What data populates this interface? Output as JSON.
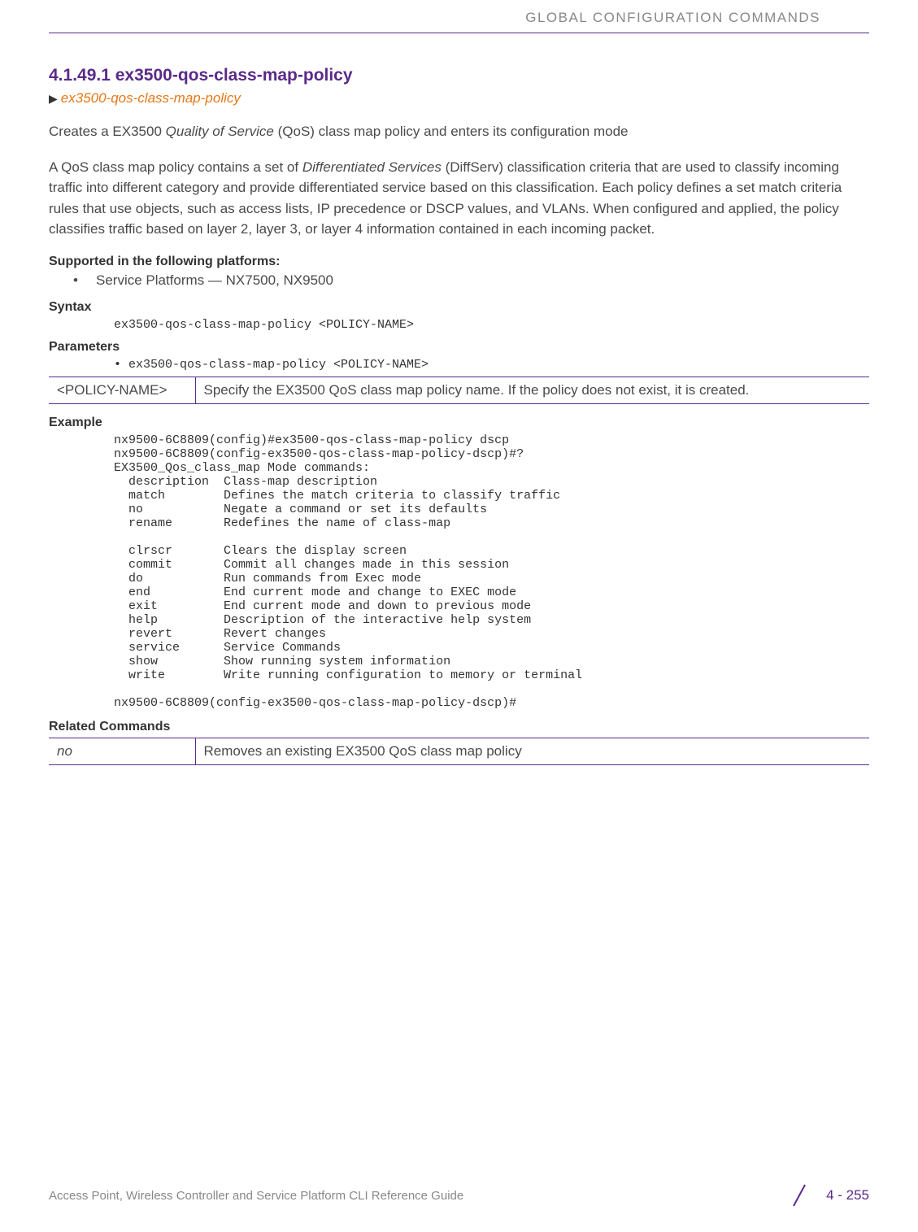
{
  "header": {
    "title": "GLOBAL CONFIGURATION COMMANDS"
  },
  "section": {
    "number": "4.1.49.1",
    "title": "ex3500-qos-class-map-policy",
    "breadcrumb": "ex3500-qos-class-map-policy"
  },
  "intro_pre": "Creates a EX3500 ",
  "intro_italic": "Quality of Service",
  "intro_post": " (QoS) class map policy and enters its configuration mode",
  "desc_pre": "A QoS class map policy contains a set of ",
  "desc_italic": "Differentiated Services",
  "desc_post": " (DiffServ) classification criteria that are used to classify incoming traffic into different category and provide differentiated service based on this classification. Each policy defines a set match criteria rules that use objects, such as access lists, IP precedence or DSCP values, and VLANs. When configured and applied, the policy classifies traffic based on layer 2, layer 3, or layer 4 information contained in each incoming packet.",
  "platforms": {
    "heading": "Supported in the following platforms:",
    "item": "Service Platforms — NX7500, NX9500"
  },
  "syntax": {
    "heading": "Syntax",
    "line": "ex3500-qos-class-map-policy <POLICY-NAME>"
  },
  "parameters": {
    "heading": "Parameters",
    "bullet": "• ex3500-qos-class-map-policy <POLICY-NAME>",
    "name": "<POLICY-NAME>",
    "desc": "Specify the EX3500 QoS class map policy name. If the policy does not exist, it is created."
  },
  "example": {
    "heading": "Example",
    "text": "nx9500-6C8809(config)#ex3500-qos-class-map-policy dscp\nnx9500-6C8809(config-ex3500-qos-class-map-policy-dscp)#?\nEX3500_Qos_class_map Mode commands:\n  description  Class-map description\n  match        Defines the match criteria to classify traffic\n  no           Negate a command or set its defaults\n  rename       Redefines the name of class-map\n\n  clrscr       Clears the display screen\n  commit       Commit all changes made in this session\n  do           Run commands from Exec mode\n  end          End current mode and change to EXEC mode\n  exit         End current mode and down to previous mode\n  help         Description of the interactive help system\n  revert       Revert changes\n  service      Service Commands\n  show         Show running system information\n  write        Write running configuration to memory or terminal\n\nnx9500-6C8809(config-ex3500-qos-class-map-policy-dscp)#"
  },
  "related": {
    "heading": "Related Commands",
    "cmd": "no",
    "desc": "Removes an existing EX3500 QoS class map policy"
  },
  "footer": {
    "left": "Access Point, Wireless Controller and Service Platform CLI Reference Guide",
    "page": "4 - 255"
  }
}
